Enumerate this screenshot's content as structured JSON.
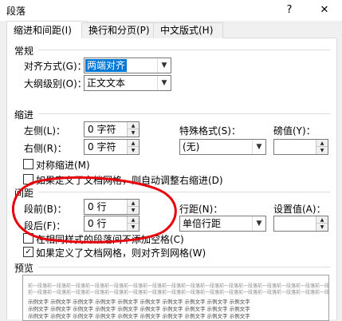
{
  "window": {
    "title": "段落",
    "help_icon": "?",
    "close_icon": "✕"
  },
  "tabs": [
    "缩进和间距(I)",
    "换行和分页(P)",
    "中文版式(H)"
  ],
  "general": {
    "section": "常规",
    "alignment_label": "对齐方式(G)：",
    "alignment_value": "两端对齐",
    "outline_label": "大纲级别(O)：",
    "outline_value": "正文文本"
  },
  "indent": {
    "section": "缩进",
    "left_label": "左侧(L)：",
    "left_value": "0 字符",
    "right_label": "右侧(R)：",
    "right_value": "0 字符",
    "special_label": "特殊格式(S)：",
    "special_value": "(无)",
    "by_label": "磅值(Y)：",
    "by_value": "",
    "mirror_label": "对称缩进(M)",
    "auto_adjust_label": "如果定义了文档网格，则自动调整右缩进(D)"
  },
  "spacing": {
    "section": "间距",
    "before_label": "段前(B)：",
    "before_value": "0 行",
    "after_label": "段后(F)：",
    "after_value": "0 行",
    "line_label": "行距(N)：",
    "line_value": "单倍行距",
    "at_label": "设置值(A)：",
    "at_value": "",
    "no_space_label": "在相同样式的段落间不添加空格(C)",
    "snap_grid_label": "如果定义了文档网格，则对齐到网格(W)",
    "snap_grid_checked": "✓"
  },
  "preview": {
    "section": "预览",
    "prev_text": "前一段落前一段落前一段落前一段落前一段落前一段落前一段落前一段落前一段落前一段落前一段落前一段落前一段落前一段落前一段落前一段落",
    "sample_text": "示例文字 示例文字 示例文字 示例文字 示例文字 示例文字 示例文字 示例文字 示例文字 示例文字"
  },
  "annotation_color": "#e8000b"
}
